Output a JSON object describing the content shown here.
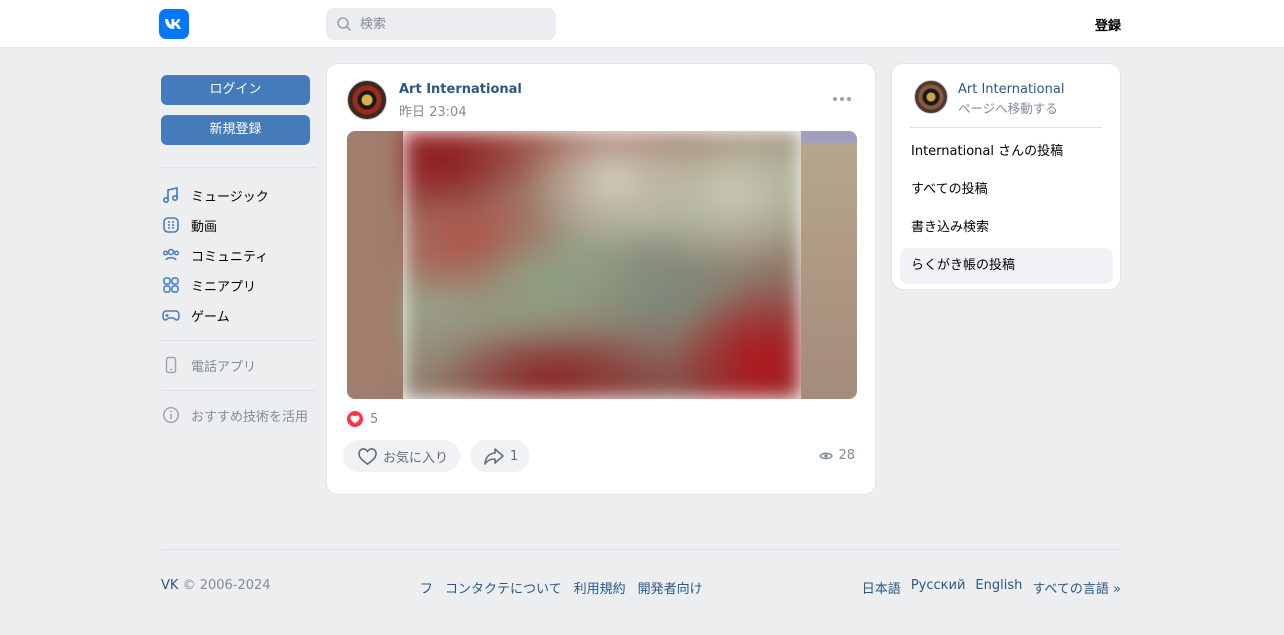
{
  "header": {
    "search_placeholder": "検索",
    "register_label": "登録"
  },
  "sidebar": {
    "login_label": "ログイン",
    "signup_label": "新規登録",
    "items": [
      {
        "label": "ミュージック",
        "icon": "music-icon"
      },
      {
        "label": "動画",
        "icon": "video-icon"
      },
      {
        "label": "コミュニティ",
        "icon": "community-icon"
      },
      {
        "label": "ミニアプリ",
        "icon": "apps-icon"
      },
      {
        "label": "ゲーム",
        "icon": "gamepad-icon"
      }
    ],
    "phone_app_label": "電話アプリ",
    "tech_label": "おすすめ技術を活用"
  },
  "post": {
    "author": "Art International",
    "time": "昨日 23:04",
    "likes_count": "5",
    "favorite_label": "お気に入り",
    "shares_count": "1",
    "views_count": "28"
  },
  "right_panel": {
    "name": "Art International",
    "subtitle": "ページへ移動する",
    "links": [
      "International さんの投稿",
      "すべての投稿",
      "書き込み検索",
      "らくがき帳の投稿"
    ]
  },
  "footer": {
    "brand": "VK",
    "copyright": "© 2006-2024",
    "links": [
      "フ",
      "コンタクテについて",
      "利用規約",
      "開発者向け"
    ],
    "languages": [
      "日本語",
      "Русский",
      "English",
      "すべての言語 »"
    ]
  },
  "colors": {
    "accent": "#0077ff",
    "button_blue": "#447bba",
    "link": "#2a5885",
    "like_red": "#ff3347"
  }
}
